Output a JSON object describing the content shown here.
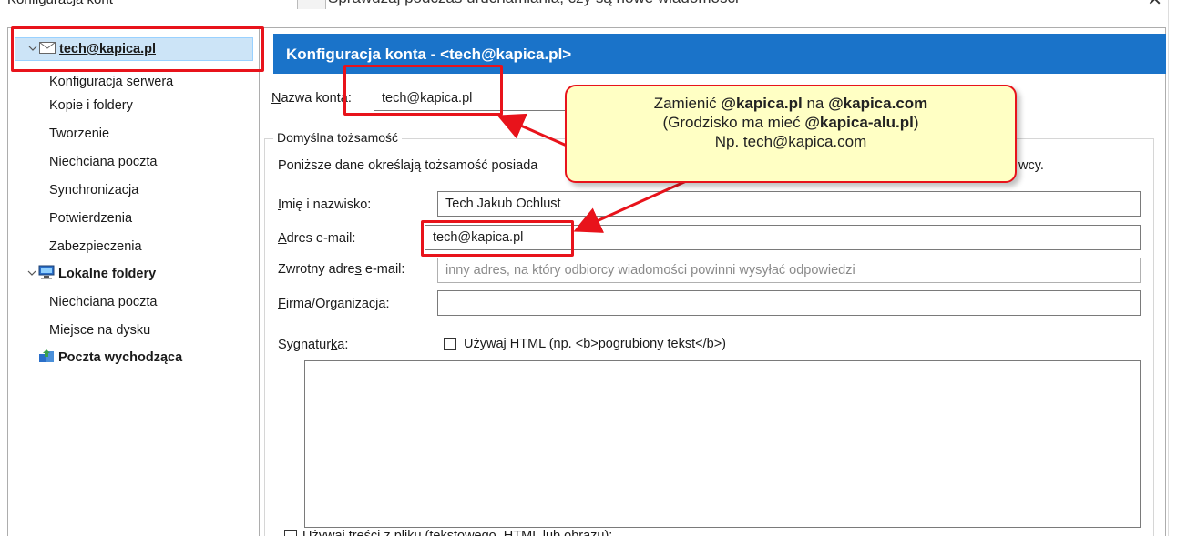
{
  "window": {
    "title": "Konfiguracja kont",
    "top_dialog_text": "Sprawdzaj podczas uruchamiania, czy są nowe wiadomości",
    "close_glyph": "✕"
  },
  "sidebar": {
    "account": {
      "chevron": "v",
      "icon": "envelope-icon",
      "label": "tech@kapica.pl"
    },
    "account_children": [
      "Konfiguracja serwera",
      "Kopie i foldery",
      "Tworzenie",
      "Niechciana poczta",
      "Synchronizacja",
      "Potwierdzenia",
      "Zabezpieczenia"
    ],
    "local": {
      "chevron": "v",
      "icon": "computer-icon",
      "label": "Lokalne foldery"
    },
    "local_children": [
      "Niechciana poczta",
      "Miejsce na dysku"
    ],
    "outgoing": {
      "icon": "outgoing-server-icon",
      "label": "Poczta wychodząca"
    }
  },
  "header": {
    "title": "Konfiguracja konta - <tech@kapica.pl>"
  },
  "form": {
    "account_name_label": "Nazwa konta:",
    "account_name_value": "tech@kapica.pl",
    "identity_group_title": "Domyślna tożsamość",
    "identity_desc_left": "Poniższe dane określają tożsamość posiada",
    "identity_desc_right": "wcy.",
    "name_label": "Imię i nazwisko:",
    "name_value": "Tech Jakub Ochlust",
    "email_label": "Adres e-mail:",
    "email_value": "tech@kapica.pl",
    "reply_label": "Zwrotny adres e-mail:",
    "reply_placeholder": "inny adres, na który odbiorcy wiadomości powinni wysyłać odpowiedzi",
    "org_label": "Firma/Organizacja:",
    "org_value": "",
    "signature_label": "Sygnaturka:",
    "use_html_label": "Używaj HTML (np. <b>pogrubiony tekst</b>)",
    "use_file_label": "Używaj treści z pliku (tekstowego, HTML lub obrazu):"
  },
  "callout": {
    "line1_pre": "Zamienić ",
    "line1_b1": "@kapica.pl",
    "line1_mid": " na ",
    "line1_b2": "@kapica.com",
    "line2_pre": "(Grodzisko ma mieć ",
    "line2_b": "@kapica-alu.pl",
    "line2_post": ")",
    "line3": "Np. tech@kapica.com"
  },
  "colors": {
    "accent": "#1a73c9",
    "highlight": "#e8131b",
    "callout_bg": "#ffffc4",
    "selection": "#cce4f7"
  }
}
